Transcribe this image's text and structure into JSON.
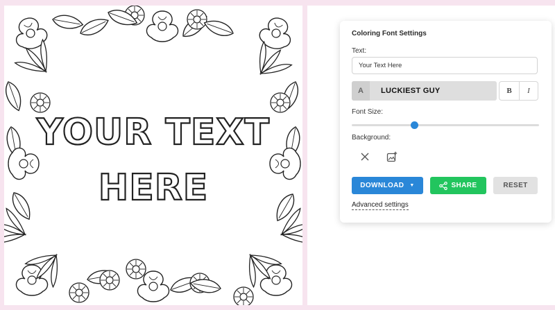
{
  "preview": {
    "line1": "YOUR TEXT",
    "line2": "HERE"
  },
  "panel": {
    "title": "Coloring Font Settings",
    "text_label": "Text:",
    "text_value": "Your Text Here",
    "font_icon_letter": "A",
    "font_name": "LUCKIEST GUY",
    "bold_label": "B",
    "italic_label": "I",
    "font_size_label": "Font Size:",
    "font_size_value": 0.33,
    "background_label": "Background:",
    "background_icons": [
      "close-icon",
      "add-image-icon"
    ],
    "download_label": "DOWNLOAD",
    "share_label": "SHARE",
    "reset_label": "RESET",
    "advanced_label": "Advanced settings"
  },
  "colors": {
    "page_background": "#f7e4ef",
    "primary": "#2a87d8",
    "share": "#22c55e",
    "reset": "#e2e2e2"
  }
}
